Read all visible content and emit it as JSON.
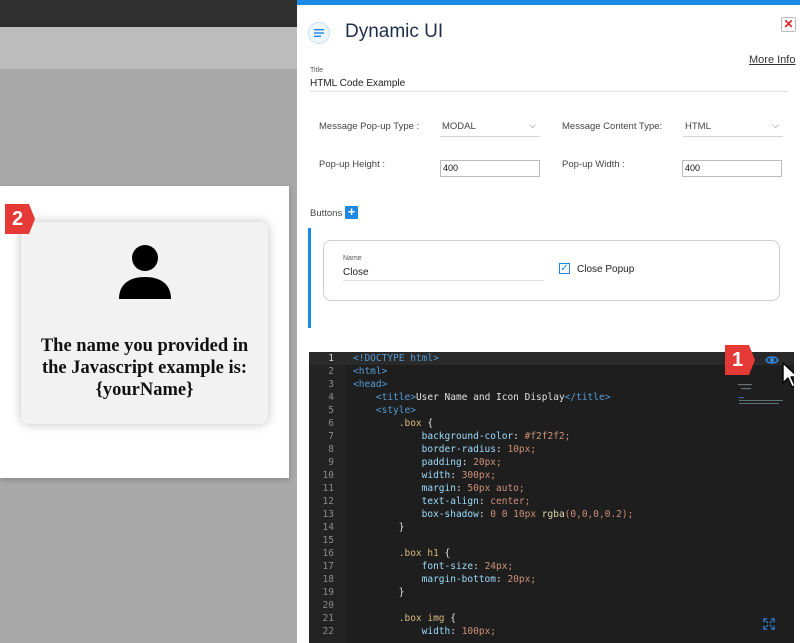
{
  "preview": {
    "message_lines": [
      "The name you provided in",
      "the Javascript example is:",
      "{yourName}"
    ],
    "badge": "2"
  },
  "panel": {
    "app_title": "Dynamic UI",
    "close_icon": "close-x-icon",
    "more_info": "More Info",
    "title_label": "Title",
    "title_value": "HTML Code Example",
    "popup_type_label": "Message Pop-up Type :",
    "popup_type_value": "MODAL",
    "content_type_label": "Message Content Type:",
    "content_type_value": "HTML",
    "height_label": "Pop-up Height :",
    "height_value": "400",
    "width_label": "Pop-up Width :",
    "width_value": "400",
    "buttons_label": "Buttons",
    "button_card": {
      "name_label": "Name",
      "name_value": "Close",
      "close_popup_label": "Close Popup",
      "close_popup_checked": true
    },
    "accent_color": "#1e88e5"
  },
  "editor": {
    "badge": "1",
    "lines": [
      {
        "n": "1",
        "t": "<!DOCTYPE html>"
      },
      {
        "n": "2",
        "t": "<html>"
      },
      {
        "n": "3",
        "t": "<head>"
      },
      {
        "n": "4",
        "t": "    <title>User Name and Icon Display</title>"
      },
      {
        "n": "5",
        "t": "    <style>"
      },
      {
        "n": "6",
        "t": "        .box {"
      },
      {
        "n": "7",
        "t": "            background-color: #f2f2f2;"
      },
      {
        "n": "8",
        "t": "            border-radius: 10px;"
      },
      {
        "n": "9",
        "t": "            padding: 20px;"
      },
      {
        "n": "10",
        "t": "            width: 300px;"
      },
      {
        "n": "11",
        "t": "            margin: 50px auto;"
      },
      {
        "n": "12",
        "t": "            text-align: center;"
      },
      {
        "n": "13",
        "t": "            box-shadow: 0 0 10px rgba(0,0,0,0.2);"
      },
      {
        "n": "14",
        "t": "        }"
      },
      {
        "n": "15",
        "t": ""
      },
      {
        "n": "16",
        "t": "        .box h1 {"
      },
      {
        "n": "17",
        "t": "            font-size: 24px;"
      },
      {
        "n": "18",
        "t": "            margin-bottom: 20px;"
      },
      {
        "n": "19",
        "t": "        }"
      },
      {
        "n": "20",
        "t": ""
      },
      {
        "n": "21",
        "t": "        .box img {"
      },
      {
        "n": "22",
        "t": "            width: 100px;"
      }
    ]
  }
}
